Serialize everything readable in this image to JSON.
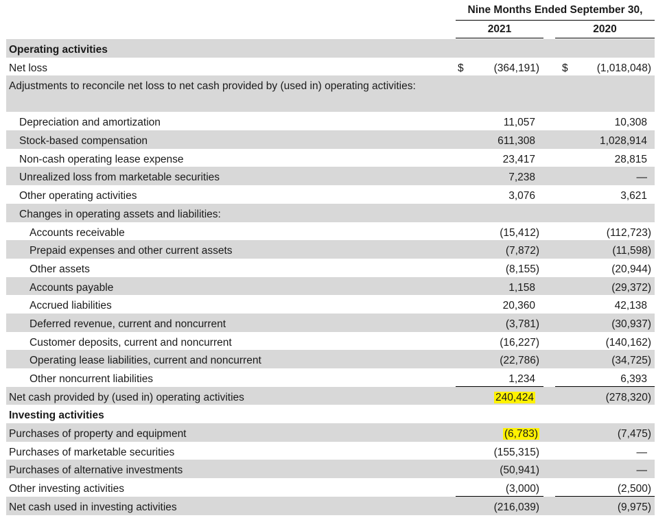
{
  "header": {
    "period": "Nine Months Ended September 30,",
    "year1": "2021",
    "year2": "2020"
  },
  "rows": [
    {
      "label": "Operating activities",
      "bold": true,
      "indent": 0,
      "shade": true,
      "v1": "",
      "v2": ""
    },
    {
      "label": "Net loss",
      "indent": 0,
      "cur1": "$",
      "cur2": "$",
      "v1": "(364,191)",
      "v2": "(1,018,048)"
    },
    {
      "label": "Adjustments to reconcile net loss to net cash provided by (used in) operating activities:",
      "indent": 0,
      "shade": true,
      "tall": true,
      "v1": "",
      "v2": ""
    },
    {
      "label": "Depreciation and amortization",
      "indent": 1,
      "v1": "11,057",
      "v2": "10,308"
    },
    {
      "label": "Stock-based compensation",
      "indent": 1,
      "shade": true,
      "v1": "611,308",
      "v2": "1,028,914"
    },
    {
      "label": "Non-cash operating lease expense",
      "indent": 1,
      "v1": "23,417",
      "v2": "28,815"
    },
    {
      "label": "Unrealized loss from marketable securities",
      "indent": 1,
      "shade": true,
      "v1": "7,238",
      "v2": "—"
    },
    {
      "label": "Other operating activities",
      "indent": 1,
      "v1": "3,076",
      "v2": "3,621"
    },
    {
      "label": "Changes in operating assets and liabilities:",
      "indent": 1,
      "shade": true,
      "v1": "",
      "v2": ""
    },
    {
      "label": "Accounts receivable",
      "indent": 2,
      "v1": "(15,412)",
      "v2": "(112,723)"
    },
    {
      "label": "Prepaid expenses and other current assets",
      "indent": 2,
      "shade": true,
      "v1": "(7,872)",
      "v2": "(11,598)"
    },
    {
      "label": "Other assets",
      "indent": 2,
      "v1": "(8,155)",
      "v2": "(20,944)"
    },
    {
      "label": "Accounts payable",
      "indent": 2,
      "shade": true,
      "v1": "1,158",
      "v2": "(29,372)"
    },
    {
      "label": "Accrued liabilities",
      "indent": 2,
      "v1": "20,360",
      "v2": "42,138"
    },
    {
      "label": "Deferred revenue, current and noncurrent",
      "indent": 2,
      "shade": true,
      "v1": "(3,781)",
      "v2": "(30,937)"
    },
    {
      "label": "Customer deposits, current and noncurrent",
      "indent": 2,
      "v1": "(16,227)",
      "v2": "(140,162)"
    },
    {
      "label": "Operating lease liabilities, current and noncurrent",
      "indent": 2,
      "shade": true,
      "v1": "(22,786)",
      "v2": "(34,725)"
    },
    {
      "label": "Other noncurrent liabilities",
      "indent": 2,
      "v1": "1,234",
      "v2": "6,393",
      "rule": true
    },
    {
      "label": "Net cash provided by (used in) operating activities",
      "indent": 0,
      "shade": true,
      "v1": "240,424",
      "v2": "(278,320)",
      "hl1": true
    },
    {
      "label": "Investing activities",
      "bold": true,
      "indent": 0,
      "v1": "",
      "v2": ""
    },
    {
      "label": "Purchases of property and equipment",
      "indent": 0,
      "shade": true,
      "v1": "(6,783)",
      "v2": "(7,475)",
      "hl1": true
    },
    {
      "label": "Purchases of marketable securities",
      "indent": 0,
      "v1": "(155,315)",
      "v2": "—"
    },
    {
      "label": "Purchases of alternative investments",
      "indent": 0,
      "shade": true,
      "v1": "(50,941)",
      "v2": "—"
    },
    {
      "label": "Other investing activities",
      "indent": 0,
      "v1": "(3,000)",
      "v2": "(2,500)",
      "rule": true
    },
    {
      "label": "Net cash used in investing activities",
      "indent": 0,
      "shade": true,
      "v1": "(216,039)",
      "v2": "(9,975)"
    }
  ],
  "colors": {
    "shade": "#d8d8d8",
    "highlight": "#fff200"
  }
}
